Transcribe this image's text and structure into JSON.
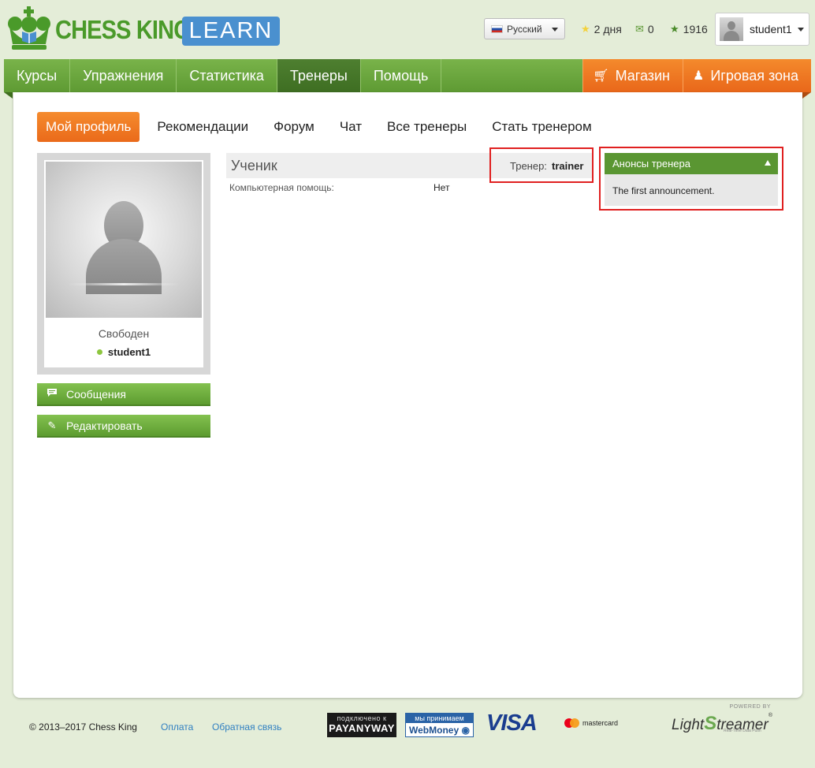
{
  "header": {
    "logo_text": "CHESS KING",
    "logo_badge": "LEARN",
    "language": "Русский",
    "stats": [
      {
        "icon": "stars-icon",
        "value": "2 дня"
      },
      {
        "icon": "mail-icon",
        "value": "0"
      },
      {
        "icon": "star-icon",
        "value": "1916"
      }
    ],
    "user": "student1"
  },
  "nav": {
    "items": [
      "Курсы",
      "Упражнения",
      "Статистика",
      "Тренеры",
      "Помощь"
    ],
    "active": "Тренеры",
    "shop": "Магазин",
    "play": "Игровая зона"
  },
  "subtabs": [
    "Мой профиль",
    "Рекомендации",
    "Форум",
    "Чат",
    "Все тренеры",
    "Стать тренером"
  ],
  "profile": {
    "status": "Свободен",
    "name": "student1",
    "messages_button": "Сообщения",
    "edit_button": "Редактировать"
  },
  "main": {
    "role": "Ученик",
    "trainer_label": "Тренер:",
    "trainer_value": "trainer",
    "field_label": "Компьютерная помощь:",
    "field_value": "Нет"
  },
  "announcements": {
    "title": "Анонсы тренера",
    "items": [
      "The first announcement."
    ]
  },
  "footer": {
    "copyright": "© 2013–2017 Chess King",
    "links": [
      "Оплата",
      "Обратная связь"
    ],
    "payanyway_top": "подключено к",
    "payanyway_name": "PAYANYWAY",
    "webmoney_top": "мы принимаем",
    "webmoney_name": "WebMoney",
    "visa": "VISA",
    "mastercard": "mastercard",
    "lightstreamer_powered": "POWERED BY",
    "lightstreamer_sub": "Real-Time Data Push"
  },
  "colors": {
    "brand_green": "#5e9a33",
    "brand_orange": "#ea6a1a",
    "highlight_red": "#e02020"
  }
}
